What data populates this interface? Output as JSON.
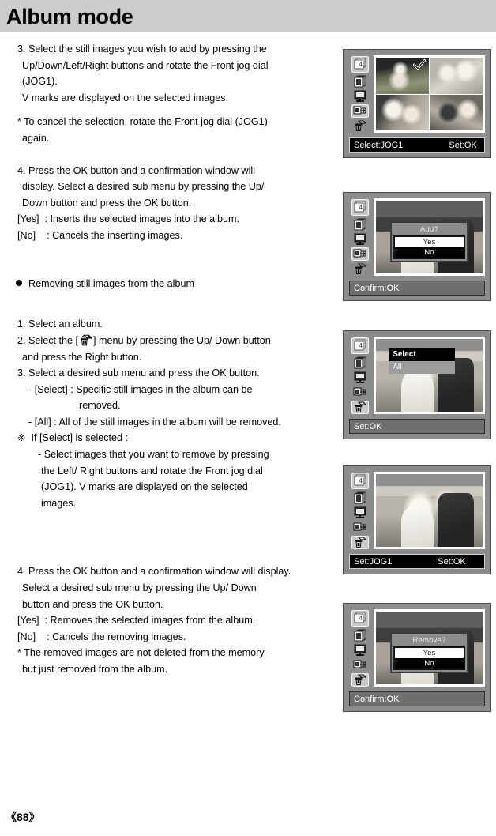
{
  "header": {
    "title": "Album mode"
  },
  "footer": {
    "page": "《88》"
  },
  "body": {
    "step3": {
      "l1": "3. Select the still images you wish to add by pressing the",
      "l2": "Up/Down/Left/Right buttons and rotate the Front jog dial",
      "l3": "(JOG1).",
      "l4": "V marks are displayed on the selected images."
    },
    "note_cancel": {
      "l1": "* To cancel the selection, rotate the Front jog dial (JOG1)",
      "l2": "again."
    },
    "step4_add": {
      "l1": "4. Press the OK button and a confirmation window will",
      "l2": "display. Select a desired sub menu by pressing the Up/",
      "l3": "Down button and press the OK button.",
      "l4": "[Yes]  : Inserts the selected images into the album.",
      "l5": "[No]    : Cancels the inserting images."
    },
    "section_removing": "Removing still images from the album",
    "remove_steps": {
      "l1": "1. Select an album.",
      "l2a": "2. Select the [",
      "l2b": "] menu by pressing the Up/ Down button",
      "l3": "and press the Right button.",
      "l4": "3. Select a desired sub menu and press the OK button.",
      "l5": "- [Select] : Specific still images in the album can be",
      "l6": "removed.",
      "l7": "- [All] : All of the still images in the album will be removed.",
      "l8": "※  If [Select] is selected :",
      "l9": "- Select images that you want to remove by pressing",
      "l10": "the Left/ Right buttons and rotate the Front jog dial",
      "l11": "(JOG1). V marks are displayed on the selected",
      "l12": "images."
    },
    "step4_remove": {
      "l1": "4. Press the OK button and a confirmation window will display.",
      "l2": "Select a desired sub menu by pressing the Up/ Down",
      "l3": "button and press the OK button.",
      "l4": "[Yes]  : Removes the selected images from the album.",
      "l5": "[No]    : Cancels the removing images.",
      "l6": "* The removed images are not deleted from the memory,",
      "l7": "but just removed from the album."
    }
  },
  "lcd": {
    "icons": {
      "album_number": "4",
      "names": [
        "album-number-icon",
        "album-pages-icon",
        "slideshow-icon",
        "add-image-icon",
        "remove-image-icon"
      ]
    },
    "panel1": {
      "status_left": "Select:JOG1",
      "status_right": "Set:OK",
      "check_mark": "selected-check"
    },
    "panel2": {
      "dialog_title": "Add?",
      "opt_yes": "Yes",
      "opt_no": "No",
      "status_left": "Confirm:OK"
    },
    "panel3": {
      "menu_select": "Select",
      "menu_all": "All",
      "status_left": "Set:OK"
    },
    "panel4": {
      "status_left": "Set:JOG1",
      "status_right": "Set:OK"
    },
    "panel5": {
      "dialog_title": "Remove?",
      "opt_yes": "Yes",
      "opt_no": "No",
      "status_left": "Confirm:OK"
    }
  },
  "colors": {
    "header_bg": "#cccccc",
    "lcd_frame": "#8c8c8c",
    "status_bg": "#000000",
    "highlight": "#000000"
  }
}
